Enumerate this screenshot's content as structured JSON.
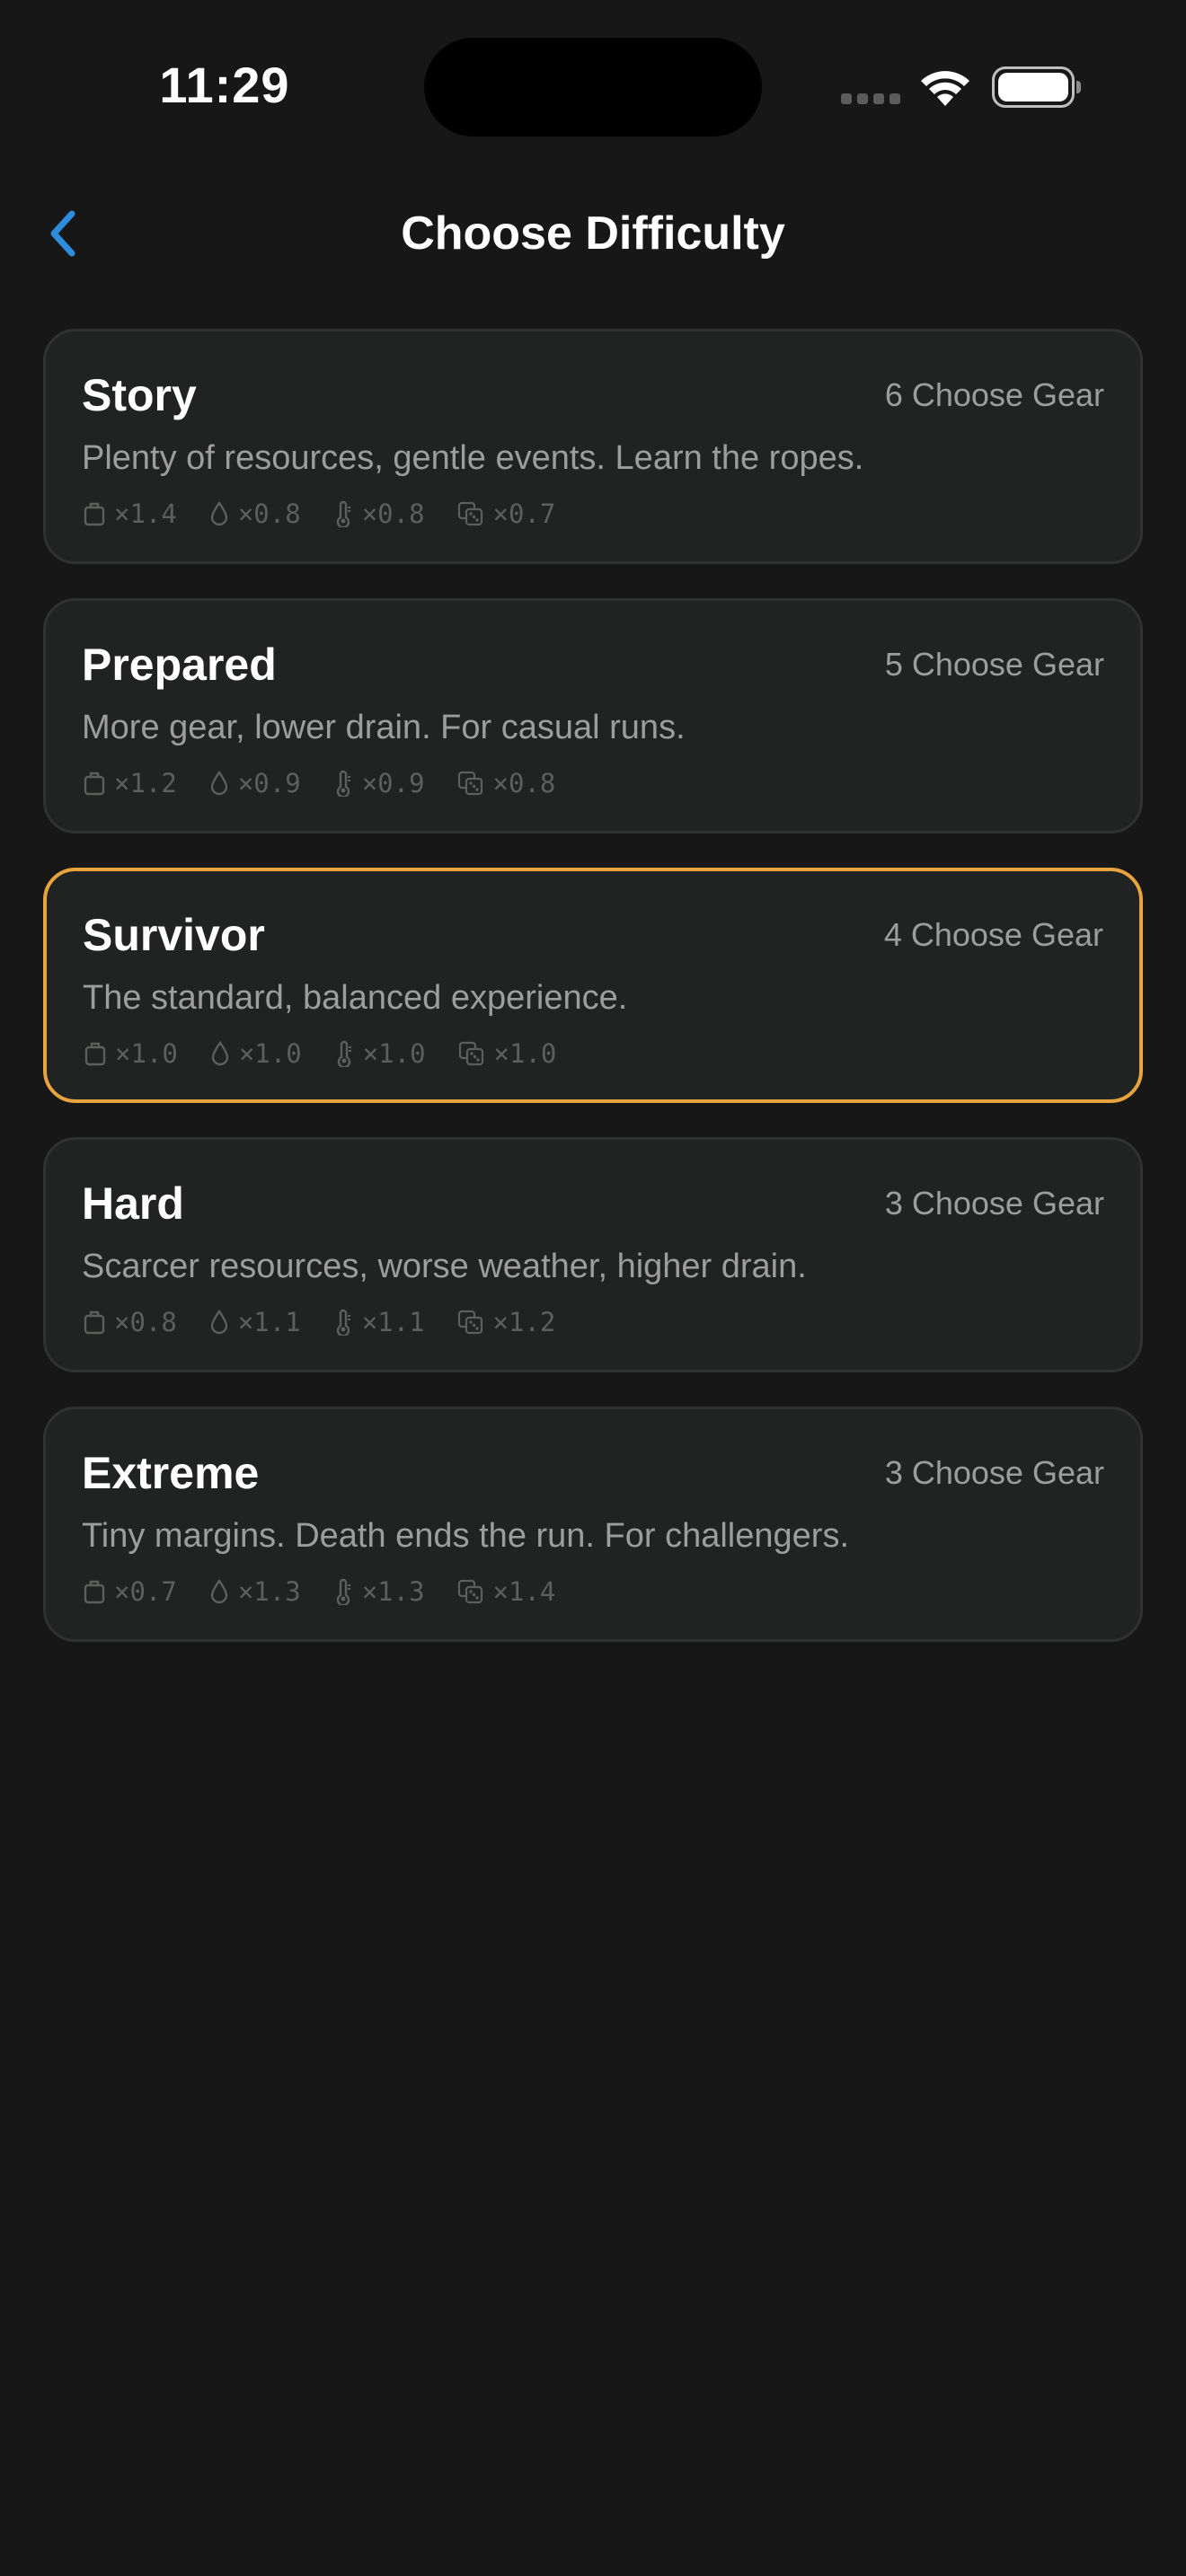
{
  "status": {
    "time": "11:29"
  },
  "nav": {
    "title": "Choose Difficulty"
  },
  "colors": {
    "background": "#161716",
    "card": "#212322",
    "selected_border": "#e7a33e",
    "back_arrow": "#2f8bdc"
  },
  "icons": [
    "chevron-left-icon",
    "bag-icon",
    "drop-icon",
    "thermometer-icon",
    "dice-icon"
  ],
  "difficulties": [
    {
      "name": "Story",
      "gear": "6 Choose Gear",
      "description": "Plenty of resources, gentle events. Learn the ropes.",
      "selected": false,
      "stats": {
        "bag": "×1.4",
        "drop": "×0.8",
        "temp": "×0.8",
        "dice": "×0.7"
      }
    },
    {
      "name": "Prepared",
      "gear": "5 Choose Gear",
      "description": "More gear, lower drain. For casual runs.",
      "selected": false,
      "stats": {
        "bag": "×1.2",
        "drop": "×0.9",
        "temp": "×0.9",
        "dice": "×0.8"
      }
    },
    {
      "name": "Survivor",
      "gear": "4 Choose Gear",
      "description": "The standard, balanced experience.",
      "selected": true,
      "stats": {
        "bag": "×1.0",
        "drop": "×1.0",
        "temp": "×1.0",
        "dice": "×1.0"
      }
    },
    {
      "name": "Hard",
      "gear": "3 Choose Gear",
      "description": "Scarcer resources, worse weather, higher drain.",
      "selected": false,
      "stats": {
        "bag": "×0.8",
        "drop": "×1.1",
        "temp": "×1.1",
        "dice": "×1.2"
      }
    },
    {
      "name": "Extreme",
      "gear": "3 Choose Gear",
      "description": "Tiny margins. Death ends the run. For challengers.",
      "selected": false,
      "stats": {
        "bag": "×0.7",
        "drop": "×1.3",
        "temp": "×1.3",
        "dice": "×1.4"
      }
    }
  ]
}
